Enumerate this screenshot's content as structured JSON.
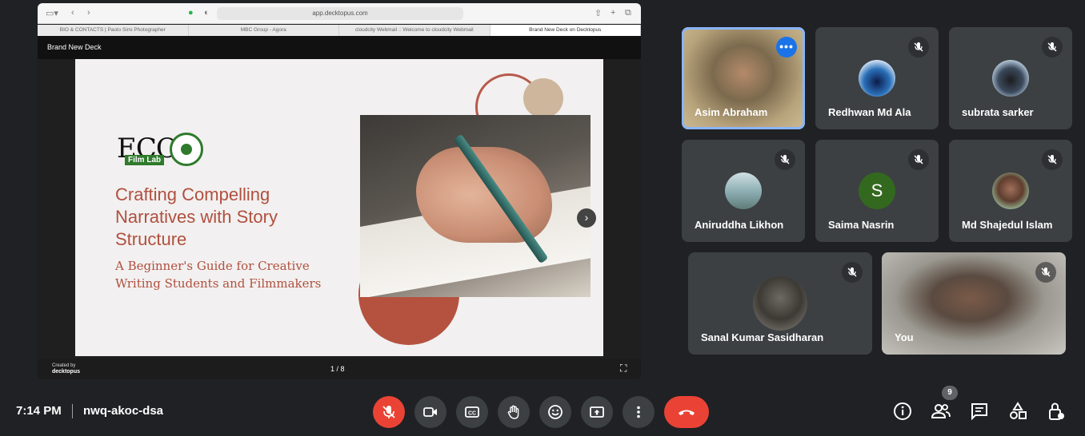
{
  "browser": {
    "url": "app.decktopus.com",
    "tabs": [
      "BIO & CONTACTS | Paolo Simi Photographer",
      "MBC Group - Agora",
      "cloudcity Webmail :: Welcome to cloudcity Webmail",
      "Brand New Deck on Decktopus"
    ]
  },
  "deck": {
    "title": "Brand New Deck",
    "logo_text": "ECO",
    "logo_badge": "Film Lab",
    "slide_title": "Crafting Compelling Narratives with Story Structure",
    "slide_subtitle": "A Beginner's Guide for Creative Writing Students and Filmmakers",
    "page_indicator": "1 / 8",
    "footer_small": "Created by",
    "footer_brand": "decktopus"
  },
  "participants": [
    {
      "name": "Asim Abraham",
      "type": "video",
      "active": true
    },
    {
      "name": "Redhwan Md Ala",
      "type": "avatar",
      "muted": true
    },
    {
      "name": "subrata sarker",
      "type": "avatar",
      "muted": true
    },
    {
      "name": "Aniruddha Likhon",
      "type": "avatar",
      "muted": true
    },
    {
      "name": "Saima Nasrin",
      "type": "letter",
      "letter": "S",
      "color": "#33691e",
      "muted": true
    },
    {
      "name": "Md Shajedul Islam",
      "type": "avatar",
      "muted": true
    },
    {
      "name": "Sanal Kumar Sasidharan",
      "type": "avatar",
      "muted": true
    },
    {
      "name": "You",
      "type": "video",
      "muted": true
    }
  ],
  "meeting": {
    "time": "7:14 PM",
    "code": "nwq-akoc-dsa",
    "participant_count": "9"
  },
  "colors": {
    "background": "#202124",
    "tile": "#3c4043",
    "danger": "#ea4335",
    "accent": "#8ab4f8",
    "slide_text": "#b0503e"
  }
}
